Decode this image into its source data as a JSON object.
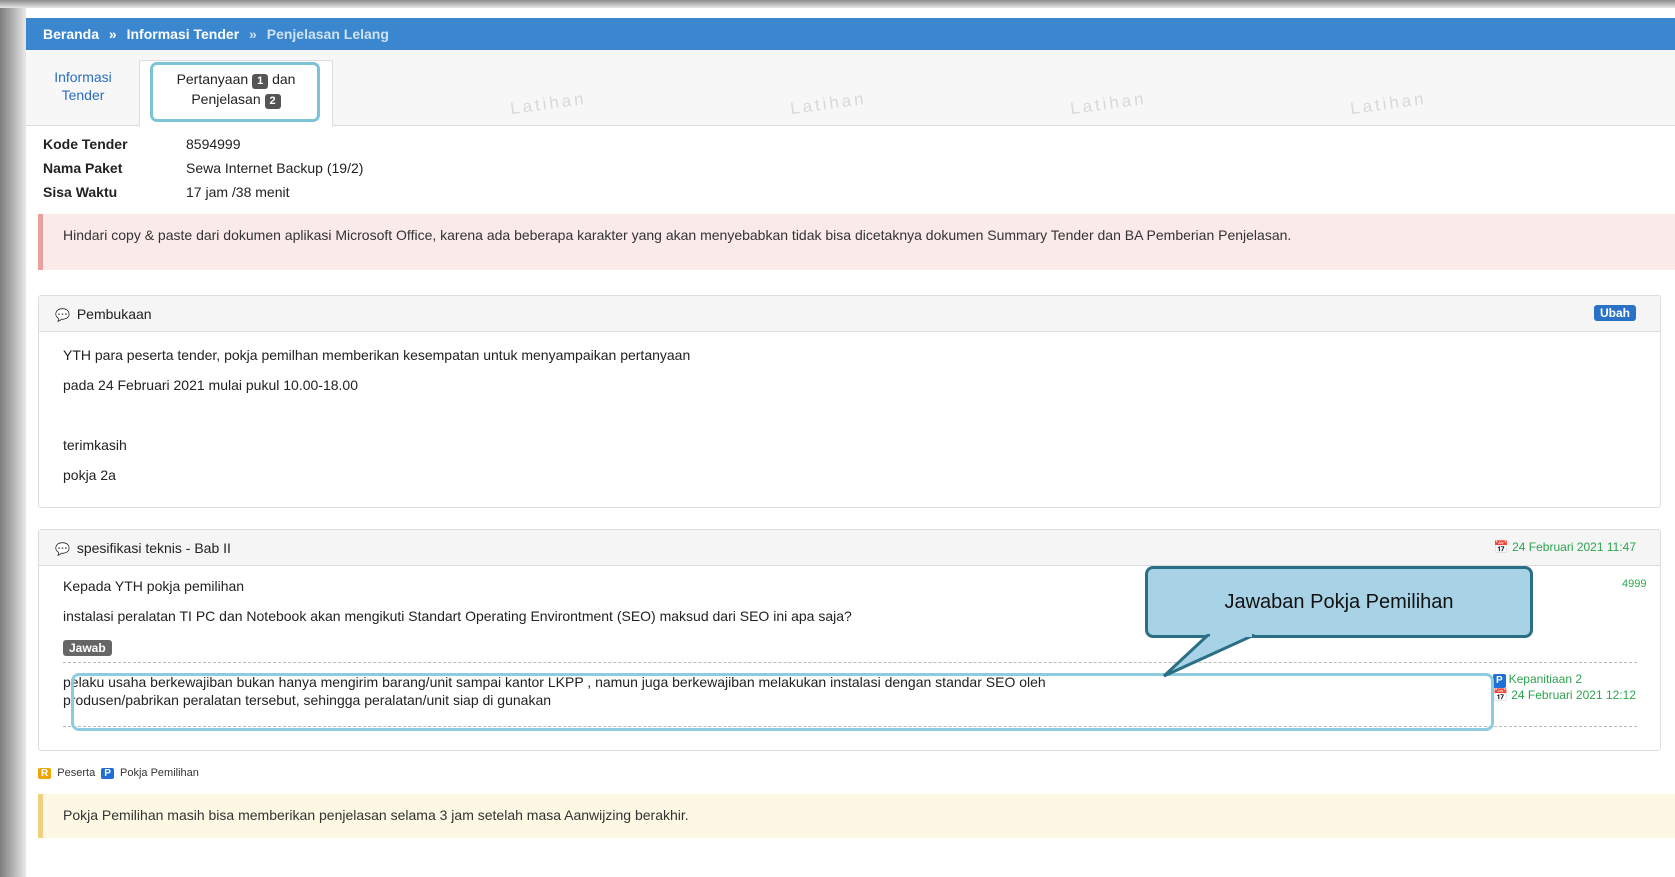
{
  "breadcrumb": {
    "home": "Beranda",
    "sep": "»",
    "section": "Informasi Tender",
    "current": "Penjelasan Lelang"
  },
  "tabs": {
    "info_line1": "Informasi",
    "info_line2": "Tender",
    "active_pre": "Pertanyaan",
    "active_count1": "1",
    "active_mid": "dan",
    "active_line2": "Penjelasan",
    "active_count2": "2"
  },
  "watermark": "Latihan",
  "info": {
    "kode_label": "Kode Tender",
    "kode_value": "8594999",
    "nama_label": "Nama Paket",
    "nama_value": "Sewa Internet Backup (19/2)",
    "sisa_label": "Sisa Waktu",
    "sisa_value": "17 jam /38 menit"
  },
  "alert_red": "Hindari copy & paste dari dokumen aplikasi Microsoft Office, karena ada beberapa karakter yang akan menyebabkan tidak bisa dicetaknya dokumen Summary Tender dan BA Pemberian Penjelasan.",
  "pembukaan": {
    "title": "Pembukaan",
    "edit_label": "Ubah",
    "line1": "YTH para peserta tender, pokja pemilhan memberikan kesempatan untuk menyampaikan pertanyaan",
    "line2": "pada 24 Februari 2021 mulai pukul 10.00-18.00",
    "line3": "terimkasih",
    "line4": "pokja 2a"
  },
  "spesifikasi": {
    "title": "spesifikasi teknis - Bab II",
    "date": "24 Februari 2021 11:47",
    "side_code": "4999",
    "q_line1": "Kepada YTH pokja pemilihan",
    "q_line2": "instalasi peralatan TI PC dan Notebook akan mengikuti Standart Operating Environtment (SEO) maksud dari SEO ini apa saja?",
    "answer_button": "Jawab",
    "a_line1": "pelaku usaha berkewajiban bukan hanya mengirim barang/unit sampai kantor LKPP , namun juga berkewajiban melakukan instalasi dengan standar SEO oleh",
    "a_line2": "produsen/pabrikan peralatan tersebut, sehingga peralatan/unit siap di gunakan",
    "reply_badge": "P",
    "reply_author": "Kepanitiaan 2",
    "reply_date": "24 Februari 2021 12:12"
  },
  "callout": "Jawaban Pokja Pemilihan",
  "legend": {
    "r_badge": "R",
    "r_label": "Peserta",
    "p_badge": "P",
    "p_label": "Pokja Pemilihan"
  },
  "alert_yellow": "Pokja Pemilihan masih bisa memberikan penjelasan selama 3 jam setelah masa Aanwijzing berakhir.",
  "colors": {
    "header_blue": "#3a87d0",
    "callout_fill": "#a8d3e6",
    "callout_border": "#2b6f86",
    "highlight": "#8dcbde",
    "date_green": "#2ea44f"
  }
}
